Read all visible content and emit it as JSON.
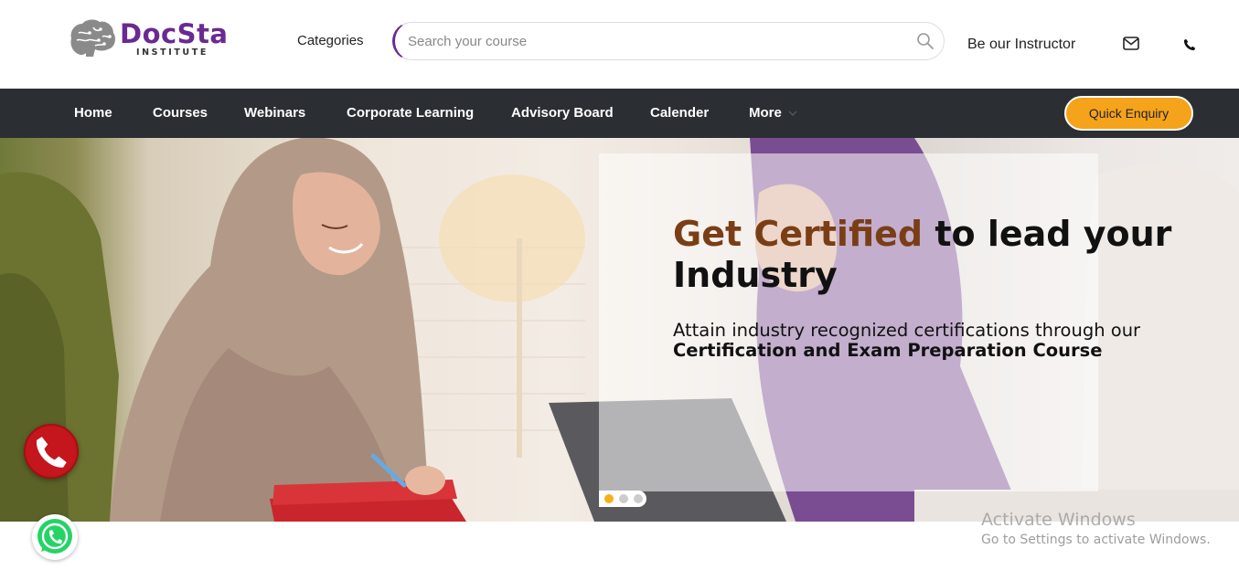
{
  "header": {
    "logo_text": "DocSta",
    "logo_subtext": "INSTITUTE",
    "categories_label": "Categories",
    "search_placeholder": "Search your course",
    "instructor_label": "Be our Instructor",
    "icons": [
      "brain-logo-icon",
      "search-icon",
      "mail-icon",
      "phone-icon"
    ]
  },
  "nav": {
    "items": [
      {
        "label": "Home"
      },
      {
        "label": "Courses"
      },
      {
        "label": "Webinars"
      },
      {
        "label": "Corporate Learning"
      },
      {
        "label": "Advisory Board"
      },
      {
        "label": "Calender"
      },
      {
        "label": "More"
      }
    ],
    "cta_label": "Quick Enquiry"
  },
  "hero": {
    "headline_accent": "Get Certified",
    "headline_rest": " to lead your Industry",
    "subline_plain": "Attain industry recognized certifications through our ",
    "subline_bold": "Certification and Exam Preparation Course",
    "slides_total": 3,
    "active_slide": 1
  },
  "watermark": {
    "line1": "Activate Windows",
    "line2": "Go to Settings to activate Windows."
  },
  "colors": {
    "brand_purple": "#6a2a91",
    "nav_bg": "#2b2e33",
    "cta_orange": "#f5a31a",
    "headline_accent": "#7a3e16",
    "call_red": "#c4161c",
    "whatsapp_green": "#25d366"
  }
}
